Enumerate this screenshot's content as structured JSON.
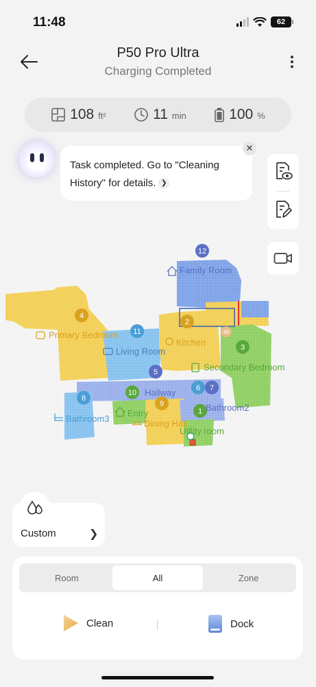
{
  "status_bar": {
    "time": "11:48",
    "battery": "62"
  },
  "header": {
    "title": "P50 Pro Ultra",
    "subtitle": "Charging Completed"
  },
  "stats": [
    {
      "icon": "area-icon",
      "value": "108",
      "unit": "ft²"
    },
    {
      "icon": "clock-icon",
      "value": "11",
      "unit": "min"
    },
    {
      "icon": "battery-icon",
      "value": "100",
      "unit": "%"
    }
  ],
  "message": {
    "line1": "Task completed. Go to \"Cleaning",
    "line2": "History\" for details."
  },
  "map": {
    "rooms": [
      {
        "number": "12",
        "label": "Family Room",
        "color": "#5b6fc4"
      },
      {
        "number": "4",
        "label": "Primary Bedroom",
        "color": "#d9a21f"
      },
      {
        "number": "11",
        "label": "Living Room",
        "color": "#4a9ed6"
      },
      {
        "number": "2",
        "label": "Kitchen",
        "color": "#d9a21f"
      },
      {
        "number": "3",
        "label": "Secondary Bedroom",
        "color": "#5aa83c"
      },
      {
        "number": "5",
        "label": "",
        "color": "#5b6fc4"
      },
      {
        "number": "10",
        "label": "Hallway",
        "color": "#5aa83c"
      },
      {
        "number": "6",
        "label": "",
        "color": "#4a9ed6"
      },
      {
        "number": "7",
        "label": "",
        "color": "#5b6fc4"
      },
      {
        "number": "8",
        "label": "Bathroom3",
        "color": "#4a9ed6"
      },
      {
        "number": "9",
        "label": "Dining Hall",
        "color": "#d9a21f"
      },
      {
        "number": "1",
        "label": "Utility room",
        "color": "#5aa83c"
      },
      {
        "number": "",
        "label": "Entry",
        "color": "#5aa83c"
      },
      {
        "number": "",
        "label": "Bathroom2",
        "color": "#5b6fc4"
      }
    ],
    "badge": "46"
  },
  "custom": {
    "label": "Custom"
  },
  "tabs": [
    {
      "label": "Room",
      "active": false
    },
    {
      "label": "All",
      "active": true
    },
    {
      "label": "Zone",
      "active": false
    }
  ],
  "actions": {
    "clean": "Clean",
    "dock": "Dock"
  }
}
